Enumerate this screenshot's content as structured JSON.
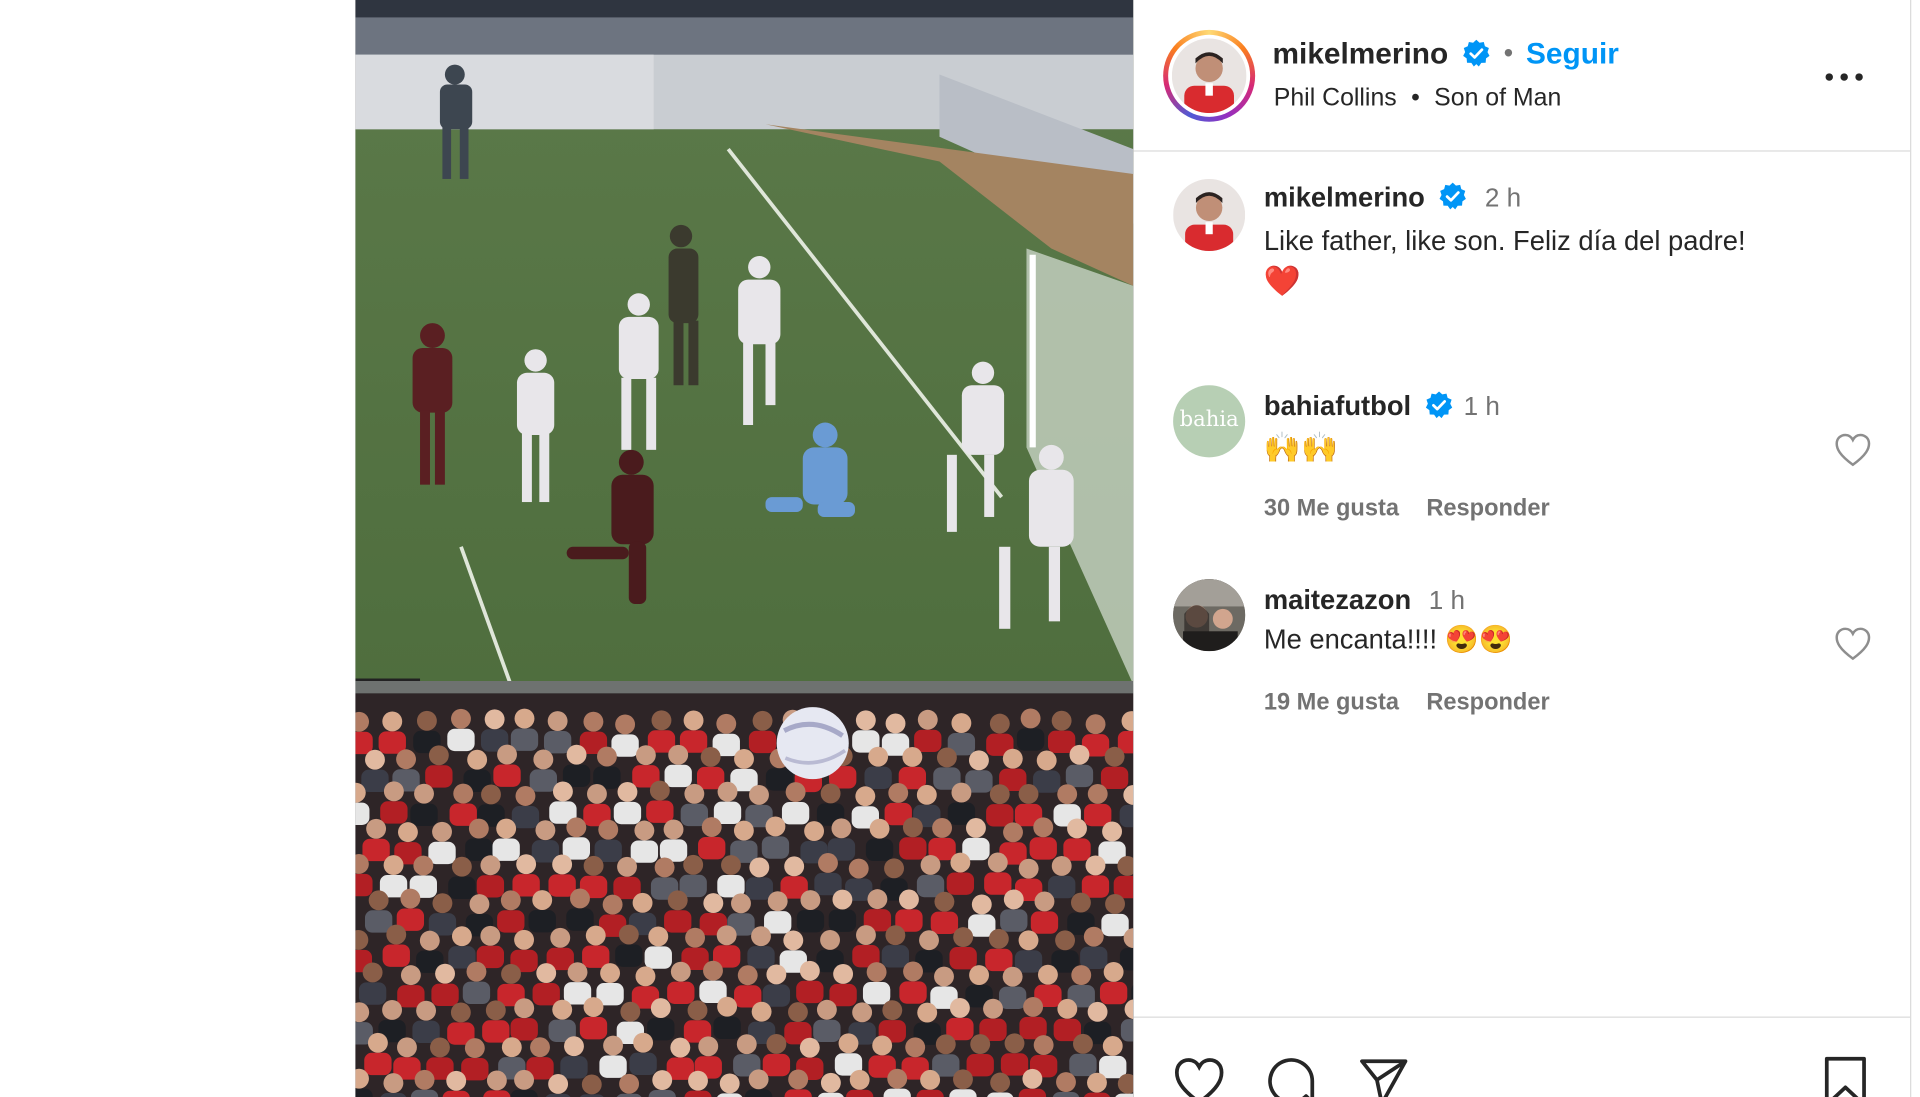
{
  "post": {
    "author": "mikelmerino",
    "follow_label": "Seguir",
    "separator": "•",
    "audio": {
      "artist": "Phil Collins",
      "track": "Son of Man",
      "separator": "•"
    },
    "caption": {
      "user": "mikelmerino",
      "time": "2 h",
      "text": "Like father, like son. Feliz día del padre!",
      "emoji": "❤️"
    }
  },
  "comments": [
    {
      "user": "bahiafutbol",
      "verified": true,
      "time": "1 h",
      "text": "🙌🙌",
      "likes": "30 Me gusta",
      "reply": "Responder",
      "avatar_text": "bahia"
    },
    {
      "user": "maitezazon",
      "verified": false,
      "time": "1 h",
      "text": "Me encanta!!!! 😍😍",
      "likes": "19 Me gusta",
      "reply": "Responder"
    }
  ],
  "icons": {
    "verified": "verified-badge-icon",
    "more": "more-options-icon",
    "like": "heart-icon",
    "comment": "comment-icon",
    "share": "share-icon",
    "save": "bookmark-icon"
  },
  "colors": {
    "accent": "#0095f6",
    "text": "#262626",
    "secondary": "#737373",
    "border": "#dbdbdb"
  }
}
